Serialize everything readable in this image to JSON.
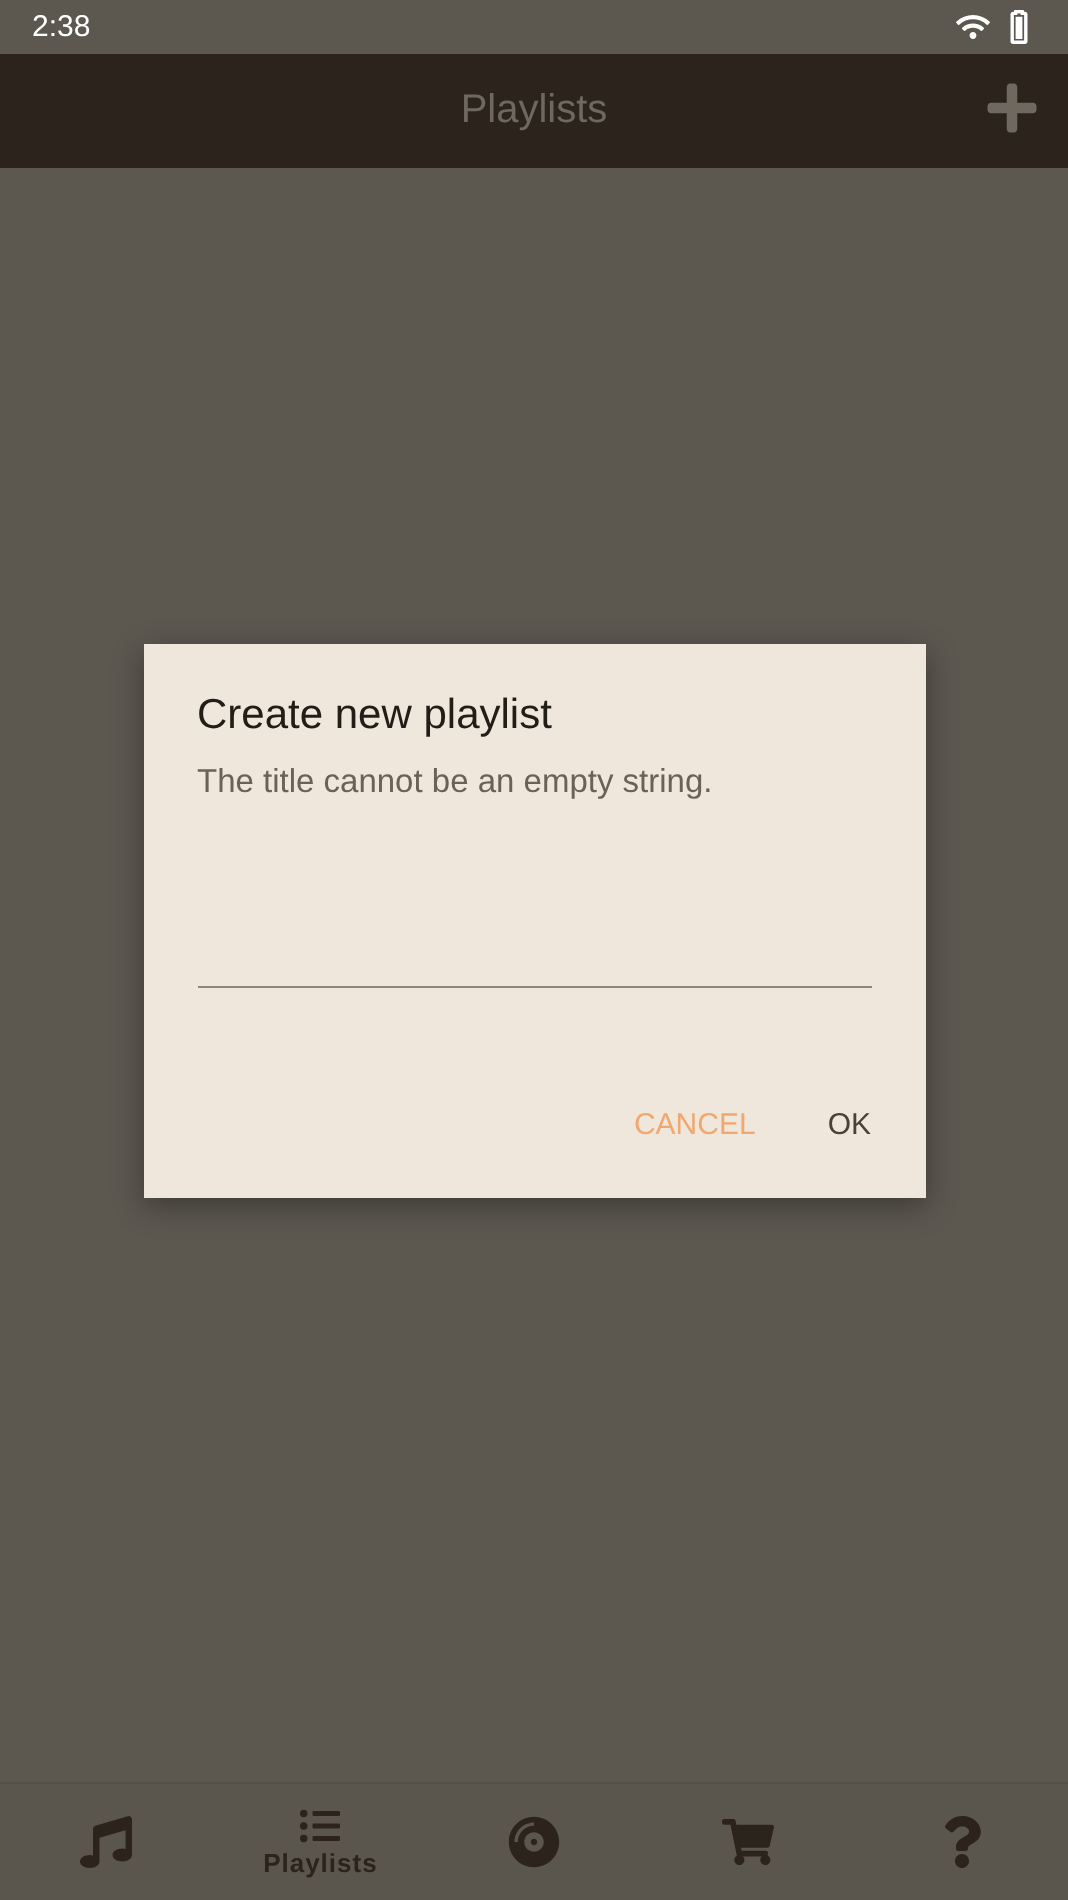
{
  "status_bar": {
    "time": "2:38"
  },
  "app_bar": {
    "title": "Playlists"
  },
  "dialog": {
    "title": "Create new playlist",
    "message": "The title cannot be an empty string.",
    "buttons": [
      {
        "label": "CANCEL",
        "kind": "secondary"
      },
      {
        "label": "OK",
        "kind": "primary"
      }
    ]
  },
  "bottom_nav": [
    {
      "kind": "music",
      "selected": false
    },
    {
      "kind": "list",
      "label": "Playlists",
      "selected": true
    },
    {
      "kind": "disc",
      "selected": false
    },
    {
      "kind": "cart",
      "selected": false
    },
    {
      "kind": "help",
      "selected": false
    }
  ]
}
